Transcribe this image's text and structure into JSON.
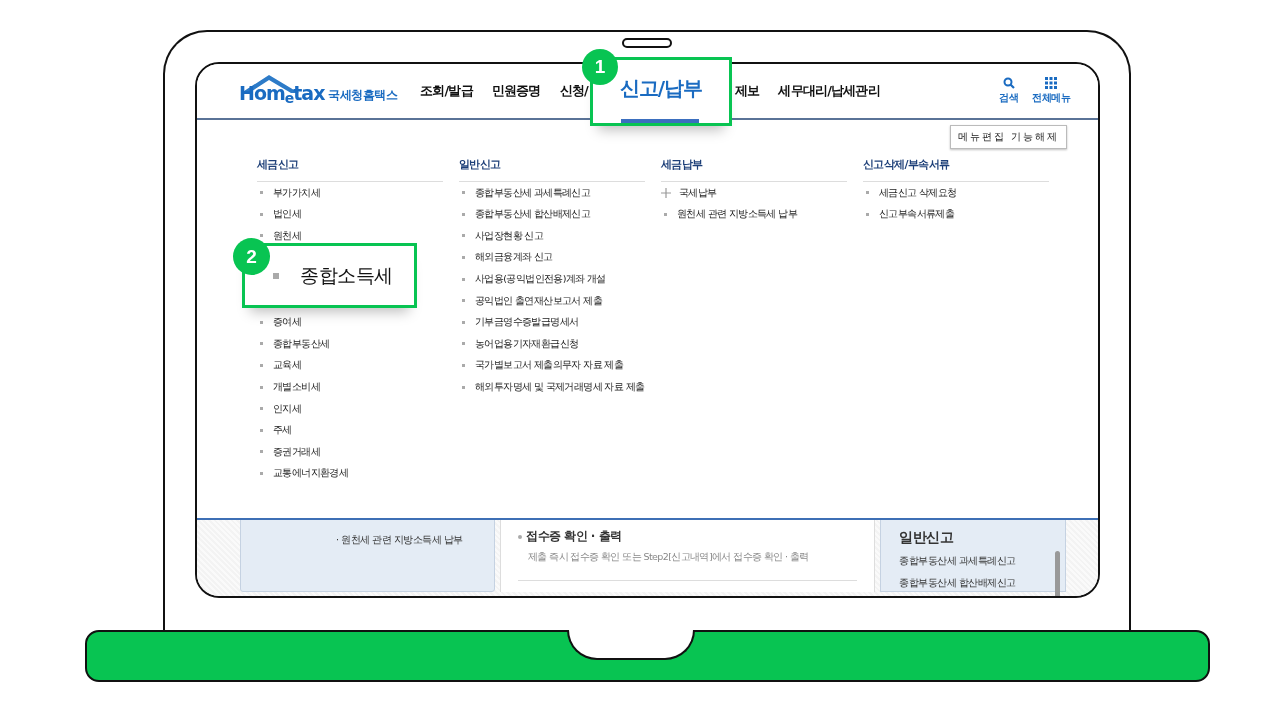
{
  "header": {
    "logo": {
      "wordmark": "Hom$_{e}$tax",
      "name": "국세청홈택스"
    },
    "nav": [
      {
        "label": "조회/발급"
      },
      {
        "label": "민원증명"
      },
      {
        "label": "신청/"
      },
      {
        "label": "제보"
      },
      {
        "label": "세무대리/납세관리"
      }
    ],
    "utilities": [
      {
        "label": "검색",
        "kind": "search"
      },
      {
        "label": "전체메뉴",
        "kind": "grid"
      }
    ]
  },
  "menu": {
    "edit_button": "메뉴편집 기능해제",
    "columns": [
      {
        "title": "세금신고",
        "items": [
          {
            "label": "부가가치세",
            "kind": "link"
          },
          {
            "label": "법인세",
            "kind": "link"
          },
          {
            "label": "원천세",
            "kind": "link"
          },
          {
            "label": "증여세",
            "kind": "link"
          },
          {
            "label": "종합부동산세",
            "kind": "link"
          },
          {
            "label": "교육세",
            "kind": "link"
          },
          {
            "label": "개별소비세",
            "kind": "link"
          },
          {
            "label": "인지세",
            "kind": "link"
          },
          {
            "label": "주세",
            "kind": "link"
          },
          {
            "label": "증권거래세",
            "kind": "link"
          },
          {
            "label": "교통에너지환경세",
            "kind": "link"
          }
        ]
      },
      {
        "title": "일반신고",
        "items": [
          {
            "label": "종합부동산세 과세특례신고",
            "kind": "link"
          },
          {
            "label": "종합부동산세 합산배제신고",
            "kind": "link"
          },
          {
            "label": "사업장현황 신고",
            "kind": "link"
          },
          {
            "label": "해외금융계좌 신고",
            "kind": "link"
          },
          {
            "label": "사업용(공익법인전용)계좌 개설",
            "kind": "link"
          },
          {
            "label": "공익법인 출연재산보고서 제출",
            "kind": "link"
          },
          {
            "label": "기부금영수증발급명세서",
            "kind": "link"
          },
          {
            "label": "농어업용기자재환급신청",
            "kind": "link"
          },
          {
            "label": "국가별보고서 제출의무자 자료 제출",
            "kind": "link"
          },
          {
            "label": "해외투자명세 및 국제거래명세 자료 제출",
            "kind": "link"
          }
        ]
      },
      {
        "title": "세금납부",
        "items": [
          {
            "label": "국세납부",
            "kind": "expandable"
          },
          {
            "label": "원천세 관련 지방소득세 납부",
            "kind": "link"
          }
        ]
      },
      {
        "title": "신고삭제/부속서류",
        "items": [
          {
            "label": "세금신고 삭제요청",
            "kind": "link"
          },
          {
            "label": "신고부속서류제출",
            "kind": "link"
          }
        ]
      }
    ]
  },
  "background": {
    "left_panel": {
      "items": [
        "· 원천세 관련 지방소득세 납부"
      ]
    },
    "middle_panel": {
      "title": "접수증 확인 · 출력",
      "description": "제출 즉시 접수증 확인 또는 Step2[신고내역]에서 접수증 확인 · 출력"
    },
    "right_panel": {
      "title": "일반신고",
      "items": [
        "종합부동산세 과세특례신고",
        "종합부동산세 합산배제신고"
      ]
    }
  },
  "callouts": [
    {
      "number": "1",
      "label": "신고/납부",
      "kind": "tab"
    },
    {
      "number": "2",
      "label": "종합소득세",
      "kind": "list-item"
    }
  ]
}
